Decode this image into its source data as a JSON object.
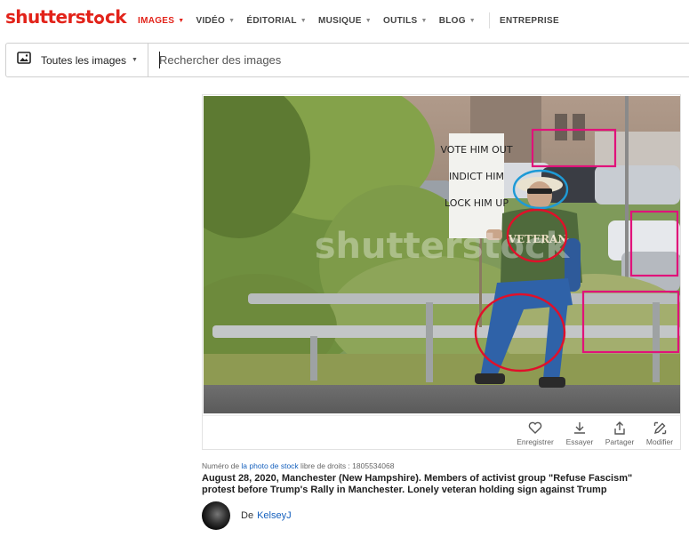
{
  "logo": {
    "pre": "shutterst",
    "post": "ck"
  },
  "nav": [
    {
      "label": "IMAGES",
      "active": true,
      "dropdown": true
    },
    {
      "label": "VIDÉO",
      "active": false,
      "dropdown": true
    },
    {
      "label": "ÉDITORIAL",
      "active": false,
      "dropdown": true
    },
    {
      "label": "MUSIQUE",
      "active": false,
      "dropdown": true
    },
    {
      "label": "OUTILS",
      "active": false,
      "dropdown": true
    },
    {
      "label": "BLOG",
      "active": false,
      "dropdown": true
    }
  ],
  "nav_extra": "ENTREPRISE",
  "search": {
    "category": "Toutes les images",
    "placeholder": "Rechercher des images",
    "value": ""
  },
  "photo": {
    "watermark": "shutterstock",
    "sign_text": [
      "VOTE HIM OUT",
      "INDICT HIM",
      "LOCK HIM UP"
    ],
    "shirt_text": "VETERAN"
  },
  "actions": [
    {
      "label": "Enregistrer",
      "icon": "heart-icon"
    },
    {
      "label": "Essayer",
      "icon": "download-icon"
    },
    {
      "label": "Partager",
      "icon": "share-icon"
    },
    {
      "label": "Modifier",
      "icon": "edit-icon"
    }
  ],
  "meta": {
    "prefix": "Numéro de ",
    "link": "la photo de stock",
    "suffix": " libre de droits : 1805534068"
  },
  "title": "August 28, 2020, Manchester (New Hampshire). Members of activist group \"Refuse Fascism\" protest before Trump's Rally in Manchester. Lonely veteran holding sign against Trump",
  "author": {
    "by": "De",
    "name": "KelseyJ"
  },
  "colors": {
    "brand": "#e2231a",
    "link": "#1560bd",
    "annotation_red": "#e0102a",
    "annotation_pink": "#e0127a",
    "annotation_blue": "#1e9ad6"
  }
}
